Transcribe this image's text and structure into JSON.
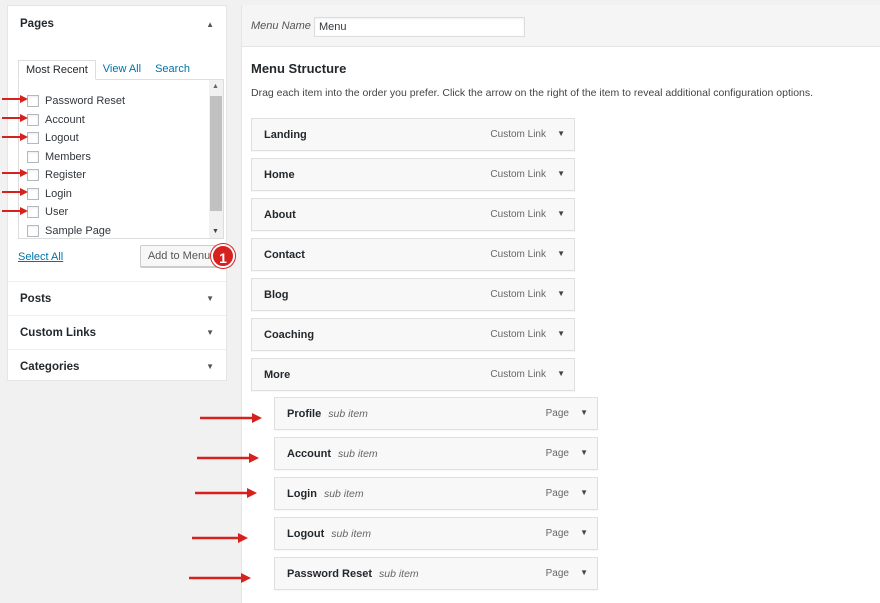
{
  "sidebar": {
    "pages": {
      "title": "Pages",
      "tabs": [
        "Most Recent",
        "View All",
        "Search"
      ],
      "items": [
        "Password Reset",
        "Account",
        "Logout",
        "Members",
        "Register",
        "Login",
        "User",
        "Sample Page"
      ],
      "select_all": "Select All",
      "add_button": "Add to Menu",
      "badge": "1"
    },
    "sections": [
      "Posts",
      "Custom Links",
      "Categories"
    ]
  },
  "main": {
    "menu_name_label": "Menu Name",
    "menu_name_value": "Menu",
    "structure_title": "Menu Structure",
    "instructions": "Drag each item into the order you prefer. Click the arrow on the right of the item to reveal additional configuration options.",
    "items": [
      {
        "title": "Landing",
        "type": "Custom Link"
      },
      {
        "title": "Home",
        "type": "Custom Link"
      },
      {
        "title": "About",
        "type": "Custom Link"
      },
      {
        "title": "Contact",
        "type": "Custom Link"
      },
      {
        "title": "Blog",
        "type": "Custom Link"
      },
      {
        "title": "Coaching",
        "type": "Custom Link"
      },
      {
        "title": "More",
        "type": "Custom Link"
      }
    ],
    "sub_items": [
      {
        "title": "Profile",
        "sub": "sub item",
        "type": "Page"
      },
      {
        "title": "Account",
        "sub": "sub item",
        "type": "Page"
      },
      {
        "title": "Login",
        "sub": "sub item",
        "type": "Page"
      },
      {
        "title": "Logout",
        "sub": "sub item",
        "type": "Page"
      },
      {
        "title": "Password Reset",
        "sub": "sub item",
        "type": "Page"
      }
    ]
  },
  "colors": {
    "accent": "#0073aa",
    "annotation_red": "#d6221e"
  }
}
